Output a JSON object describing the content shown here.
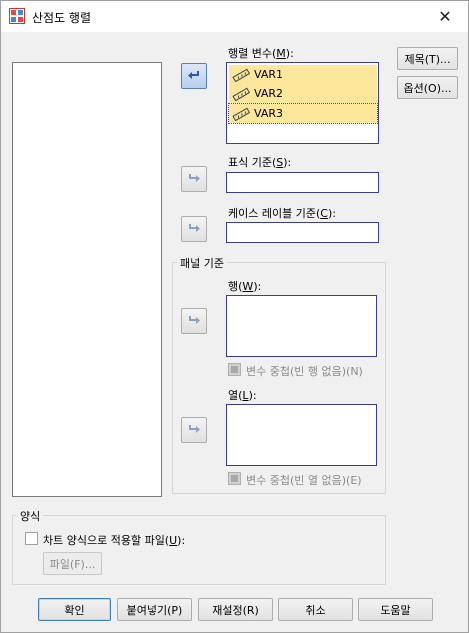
{
  "window": {
    "title": "산점도 행렬",
    "close_glyph": "✕"
  },
  "matrix_variables": {
    "label_prefix": "행렬 변수(",
    "label_key": "M",
    "label_suffix": "):",
    "items": [
      "VAR1",
      "VAR2",
      "VAR3"
    ]
  },
  "set_markers": {
    "label_prefix": "표식 기준(",
    "label_key": "S",
    "label_suffix": "):"
  },
  "case_labels": {
    "label_prefix": "케이스 레이블 기준(",
    "label_key": "C",
    "label_suffix": "):"
  },
  "panel": {
    "title": "패널 기준",
    "rows": {
      "label_prefix": "행(",
      "label_key": "W",
      "label_suffix": "):"
    },
    "rows_nest": {
      "label": "변수 중첩(빈 행 없음)(N)"
    },
    "cols": {
      "label_prefix": "열(",
      "label_key": "L",
      "label_suffix": "):"
    },
    "cols_nest": {
      "label": "변수 중첩(빈 열 없음)(E)"
    }
  },
  "template": {
    "title": "양식",
    "apply_prefix": "차트 양식으로 적용할 파일(",
    "apply_key": "U",
    "apply_suffix": "):",
    "file_button": "파일(F)..."
  },
  "side_buttons": {
    "titles": "제목(T)...",
    "options": "옵션(O)..."
  },
  "bottom_buttons": {
    "ok": "확인",
    "paste": "붙여넣기(P)",
    "reset": "재설정(R)",
    "cancel": "취소",
    "help": "도움말"
  },
  "colors": {
    "selection": "#fde79a",
    "active_border": "#3c3c96"
  },
  "icons": {
    "title": "scatterplot-matrix-icon",
    "variable": "ruler-scale-icon",
    "move_left": "arrow-left-icon",
    "move_right": "arrow-right-icon"
  }
}
